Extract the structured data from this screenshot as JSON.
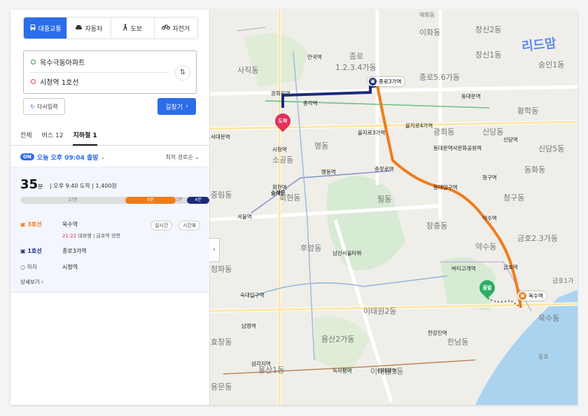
{
  "colors": {
    "accent": "#2b6dea",
    "line3": "#ef7c1c",
    "line1": "#1d2a7c",
    "dest": "#e5305b",
    "origin": "#2cae62",
    "water": "#aad3f0",
    "park": "#d7ead3",
    "road": "#ffffff",
    "major_road": "#fbe7a6"
  },
  "modes": [
    {
      "icon": "bus-icon",
      "label": "대중교통",
      "active": true
    },
    {
      "icon": "car-icon",
      "label": "자동차",
      "active": false
    },
    {
      "icon": "walk-icon",
      "label": "도보",
      "active": false
    },
    {
      "icon": "bike-icon",
      "label": "자전거",
      "active": false
    }
  ],
  "route": {
    "origin": "옥수극동아파트",
    "destination": "시청역 1호선",
    "swap_icon": "swap-icon"
  },
  "actions": {
    "reset": "다시입력",
    "search": "길찾기"
  },
  "tabs": [
    {
      "label": "전체",
      "active": false
    },
    {
      "label": "버스 12",
      "active": false
    },
    {
      "label": "지하철 1",
      "active": true
    }
  ],
  "options": {
    "toggle": "ON",
    "departure": "오늘 오후 09:04 출발",
    "sort": "최적 경로순"
  },
  "result": {
    "duration": "35",
    "duration_unit": "분",
    "arrival": "오후 9:40 도착",
    "fare": "1,400원",
    "bar": [
      {
        "label": "17분",
        "kind": "walk"
      },
      {
        "label": "9분",
        "kind": "line3"
      },
      {
        "label": "2분",
        "kind": "transfer"
      },
      {
        "label": "4분",
        "kind": "line1"
      }
    ],
    "legs": [
      {
        "line": "3호선",
        "station": "옥수역",
        "detail_time": "21:22",
        "detail": "대화행 | 금호역 방면",
        "chips": [
          "실시간",
          "시간표"
        ]
      },
      {
        "line": "1호선",
        "station": "종로3가역"
      },
      {
        "line": "하차",
        "station": "시청역"
      }
    ],
    "more": "상세보기"
  },
  "map": {
    "pin_origin": "출발",
    "pin_dest": "도착",
    "station_labels": [
      "종로3가역",
      "옥수역"
    ],
    "logo": "리드맘",
    "districts": [
      "이화동",
      "창신2동",
      "창신1동",
      "종로",
      "1.2.3.4가동",
      "종로5.6가동",
      "사직동",
      "혜화동",
      "숭인1동",
      "황학동",
      "신당동",
      "동화동",
      "청구동",
      "약수동",
      "금호2.3가동",
      "후암동",
      "회현동",
      "명동",
      "필동",
      "장충동",
      "용산2가동",
      "이태원2동",
      "한남동",
      "옥수동",
      "청파동",
      "효창동",
      "용문동",
      "신당5동",
      "광희동",
      "소공동",
      "중림동",
      "이태원1동",
      "금호1가",
      "용산1동",
      "동호"
    ],
    "stations": [
      "안국역",
      "종각역",
      "광화문역",
      "서대문역",
      "시청역",
      "을지로3가역",
      "을지로4가역",
      "동대문역",
      "동대문역사문화공원역",
      "신당역",
      "청구역",
      "충무로역",
      "동대입구역",
      "약수역",
      "금호역",
      "버티고개역",
      "한강진역",
      "회현역",
      "명동역",
      "서울역",
      "숙대입구역",
      "남영역",
      "삼각지역",
      "녹사평역",
      "이태원역",
      "숭례문",
      "남산서울타워"
    ]
  }
}
